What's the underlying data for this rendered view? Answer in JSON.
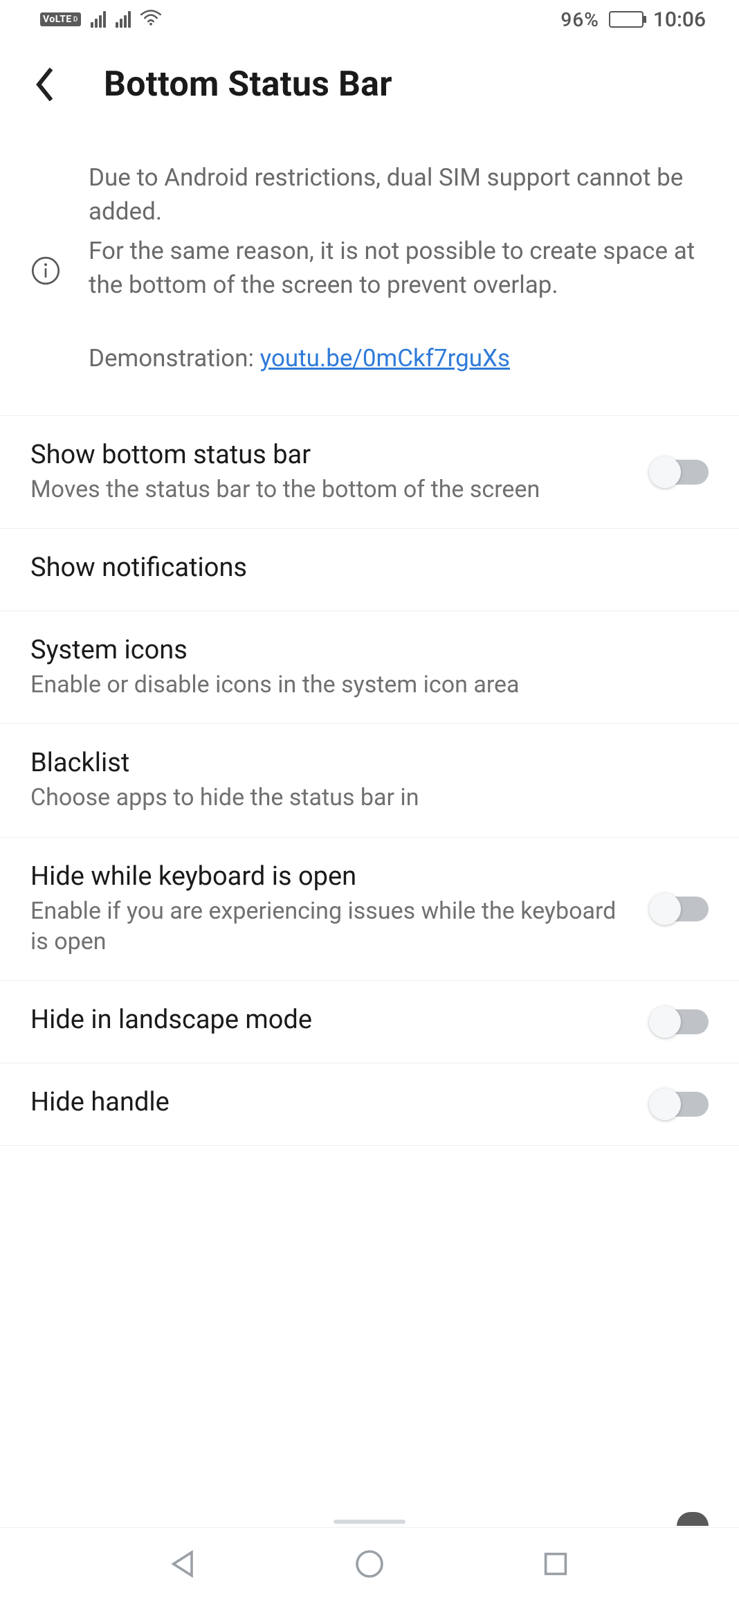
{
  "statusbar": {
    "volte": "VoLTE",
    "volte_sub": "D",
    "battery_pct": "96%",
    "time": "10:06"
  },
  "header": {
    "title": "Bottom Status Bar"
  },
  "info": {
    "line1": "Due to Android restrictions, dual SIM support cannot be added.",
    "line2": "For the same reason, it is not possible to create space at the bottom of the screen to prevent overlap.",
    "demo_label": "Demonstration: ",
    "demo_link": "youtu.be/0mCkf7rguXs"
  },
  "settings": {
    "show_bottom": {
      "title": "Show bottom status bar",
      "sub": "Moves the status bar to the bottom of the screen",
      "on": false
    },
    "show_notifications": {
      "title": "Show notifications"
    },
    "system_icons": {
      "title": "System icons",
      "sub": "Enable or disable icons in the system icon area"
    },
    "blacklist": {
      "title": "Blacklist",
      "sub": "Choose apps to hide the status bar in"
    },
    "hide_keyboard": {
      "title": "Hide while keyboard is open",
      "sub": "Enable if you are experiencing issues while the keyboard is open",
      "on": false
    },
    "hide_landscape": {
      "title": "Hide in landscape mode",
      "on": false
    },
    "hide_handle": {
      "title": "Hide handle",
      "on": false
    }
  }
}
